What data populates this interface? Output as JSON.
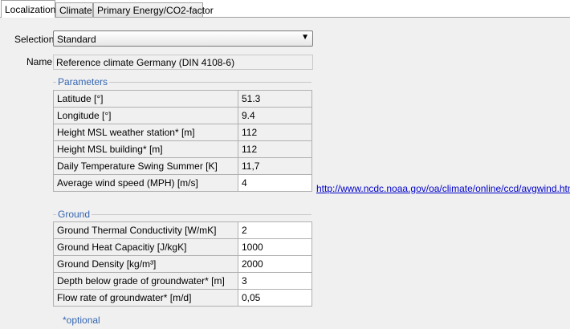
{
  "tabs": [
    {
      "label": "Localization",
      "active": true
    },
    {
      "label": "Climate",
      "active": false
    },
    {
      "label": "Primary Energy/CO2-factor",
      "active": false
    }
  ],
  "selection": {
    "label": "Selection",
    "value": "Standard"
  },
  "name": {
    "label": "Name",
    "value": "Reference climate Germany (DIN 4108-6)"
  },
  "parameters": {
    "title": "Parameters",
    "rows": [
      {
        "label": "Latitude  [°]",
        "value": "51.3",
        "editable": false
      },
      {
        "label": "Longitude  [°]",
        "value": "9.4",
        "editable": false
      },
      {
        "label": "Height MSL weather station*  [m]",
        "value": "112",
        "editable": false
      },
      {
        "label": "Height MSL building*  [m]",
        "value": "112",
        "editable": false
      },
      {
        "label": "Daily Temperature Swing Summer  [K]",
        "value": "11,7",
        "editable": false
      },
      {
        "label": "Average wind speed (MPH)  [m/s]",
        "value": "4",
        "editable": true
      }
    ],
    "link": "http://www.ncdc.noaa.gov/oa/climate/online/ccd/avgwind.html"
  },
  "ground": {
    "title": "Ground",
    "rows": [
      {
        "label": "Ground Thermal Conductivity  [W/mK]",
        "value": "2",
        "editable": true
      },
      {
        "label": "Ground Heat Capacitiy  [J/kgK]",
        "value": "1000",
        "editable": true
      },
      {
        "label": "Ground Density  [kg/m³]",
        "value": "2000",
        "editable": true
      },
      {
        "label": "Depth below grade of groundwater*  [m]",
        "value": "3",
        "editable": true
      },
      {
        "label": "Flow rate of groundwater*  [m/d]",
        "value": "0,05",
        "editable": true
      }
    ]
  },
  "footnote": "*optional"
}
